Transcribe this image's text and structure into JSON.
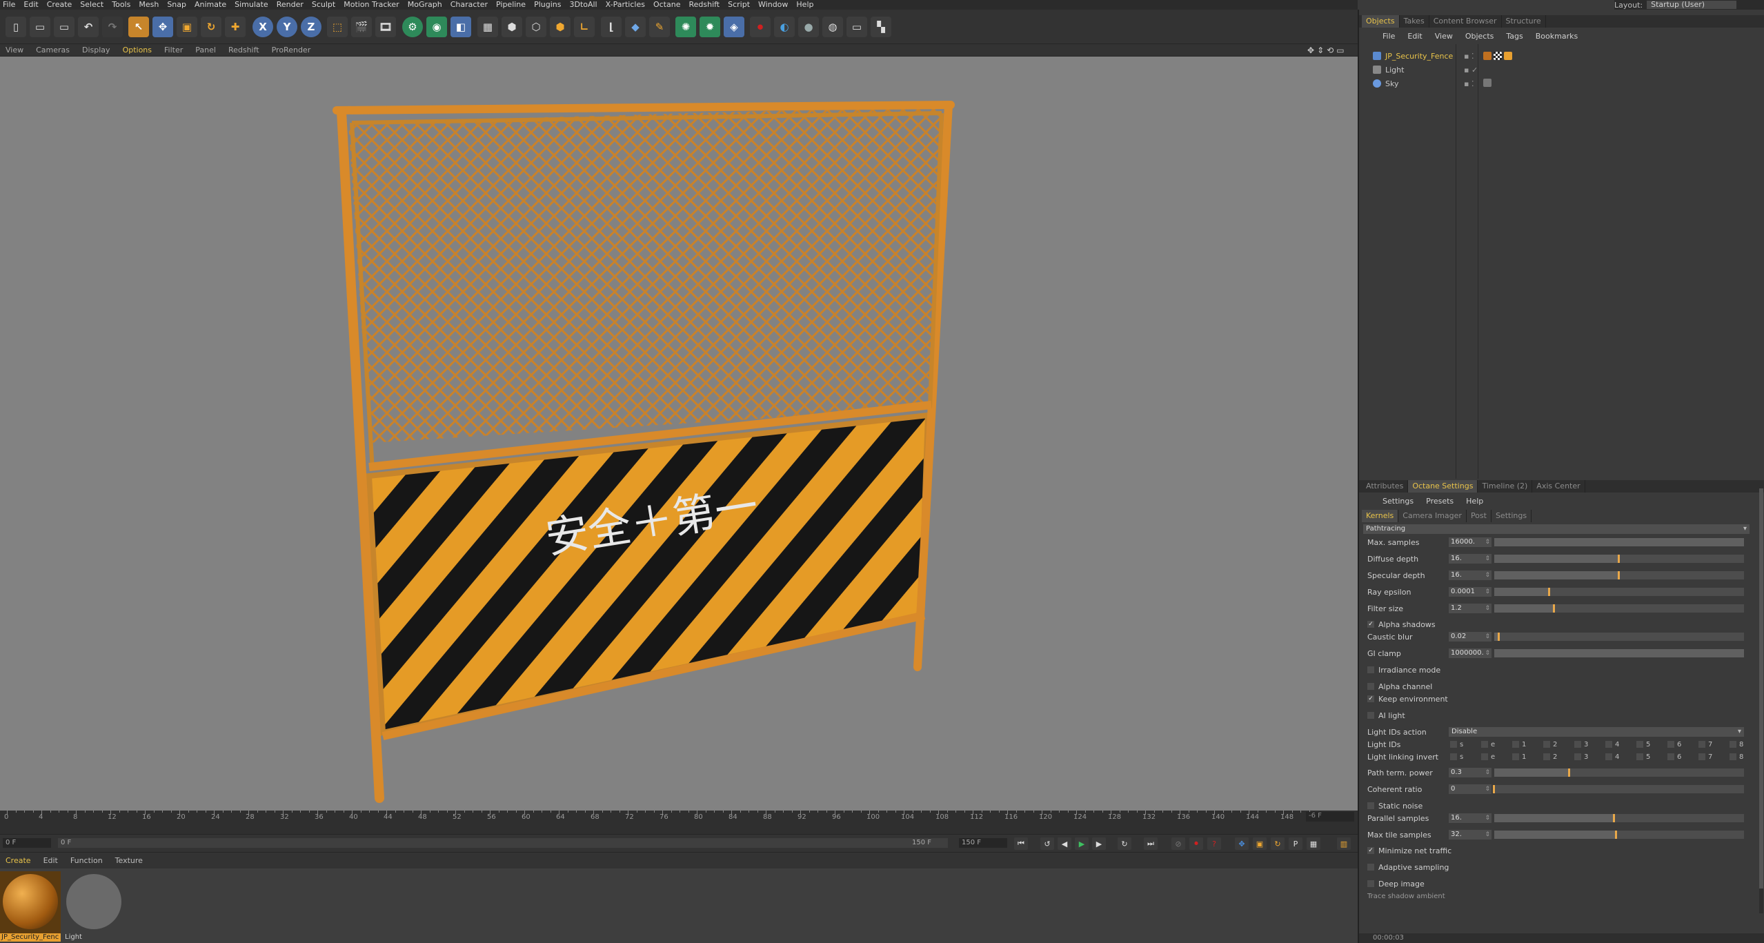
{
  "menu": [
    "File",
    "Edit",
    "Create",
    "Select",
    "Tools",
    "Mesh",
    "Snap",
    "Animate",
    "Simulate",
    "Render",
    "Sculpt",
    "Motion Tracker",
    "MoGraph",
    "Character",
    "Pipeline",
    "Plugins",
    "3DtoAll",
    "X-Particles",
    "Octane",
    "Redshift",
    "Script",
    "Window",
    "Help"
  ],
  "layout": {
    "label": "Layout:",
    "value": "Startup (User)"
  },
  "viewport_menu": [
    "View",
    "Cameras",
    "Display",
    "Options",
    "Filter",
    "Panel",
    "Redshift",
    "ProRender"
  ],
  "viewport_menu_highlight": "Options",
  "toolbar": {
    "x_axis": "X",
    "y_axis": "Y",
    "z_axis": "Z"
  },
  "fence_sign_text": "安全＋第一",
  "timeline": {
    "ticks": [
      "0",
      "4",
      "8",
      "12",
      "16",
      "20",
      "24",
      "28",
      "32",
      "36",
      "40",
      "44",
      "48",
      "52",
      "56",
      "60",
      "64",
      "68",
      "72",
      "76",
      "80",
      "84",
      "88",
      "92",
      "96",
      "100",
      "104",
      "108",
      "112",
      "116",
      "120",
      "124",
      "128",
      "132",
      "136",
      "140",
      "144",
      "148"
    ],
    "current_frame": "-6 F",
    "start_field": "0 F",
    "range_start": "0 F",
    "range_end": "150 F",
    "end_field": "150 F"
  },
  "material_manager": {
    "menu": [
      "Create",
      "Edit",
      "Function",
      "Texture"
    ],
    "materials": [
      {
        "name": "JP_Security_Fenc",
        "selected": true
      },
      {
        "name": "Light",
        "selected": false
      }
    ]
  },
  "object_manager": {
    "tabs": [
      "Objects",
      "Takes",
      "Content Browser",
      "Structure"
    ],
    "active_tab": "Objects",
    "menu": [
      "File",
      "Edit",
      "View",
      "Objects",
      "Tags",
      "Bookmarks"
    ],
    "objects": [
      {
        "name": "JP_Security_Fence",
        "selected": true
      },
      {
        "name": "Light",
        "selected": false
      },
      {
        "name": "Sky",
        "selected": false
      }
    ]
  },
  "attributes": {
    "tabs": [
      "Attributes",
      "Octane Settings",
      "Timeline (2)",
      "Axis Center"
    ],
    "active_tab": "Octane Settings",
    "menu": [
      "Settings",
      "Presets",
      "Help"
    ],
    "subtabs": [
      "Kernels",
      "Camera Imager",
      "Post",
      "Settings"
    ],
    "active_subtab": "Kernels",
    "kernel": "Pathtracing",
    "max_samples": {
      "label": "Max. samples",
      "value": "16000.",
      "fraction": 1.0
    },
    "diffuse_depth": {
      "label": "Diffuse depth",
      "value": "16.",
      "fraction": 0.5
    },
    "specular_depth": {
      "label": "Specular depth",
      "value": "16.",
      "fraction": 0.5
    },
    "ray_epsilon": {
      "label": "Ray epsilon",
      "value": "0.0001",
      "fraction": 0.22
    },
    "filter_size": {
      "label": "Filter size",
      "value": "1.2",
      "fraction": 0.24
    },
    "alpha_shadows": {
      "label": "Alpha shadows",
      "checked": true
    },
    "caustic_blur": {
      "label": "Caustic blur",
      "value": "0.02",
      "fraction": 0.02
    },
    "gi_clamp": {
      "label": "GI clamp",
      "value": "1000000.",
      "fraction": 1.0
    },
    "irradiance_mode": {
      "label": "Irradiance mode",
      "checked": false
    },
    "alpha_channel": {
      "label": "Alpha channel",
      "checked": false
    },
    "keep_environment": {
      "label": "Keep environment",
      "checked": true
    },
    "ai_light": {
      "label": "AI light",
      "checked": false
    },
    "light_ids_action": {
      "label": "Light IDs action",
      "value": "Disable"
    },
    "light_ids": {
      "label": "Light IDs",
      "items": [
        "s",
        "e",
        "1",
        "2",
        "3",
        "4",
        "5",
        "6",
        "7",
        "8"
      ]
    },
    "light_linking_invert": {
      "label": "Light linking invert",
      "items": [
        "s",
        "e",
        "1",
        "2",
        "3",
        "4",
        "5",
        "6",
        "7",
        "8"
      ]
    },
    "path_term_power": {
      "label": "Path term. power",
      "value": "0.3",
      "fraction": 0.3
    },
    "coherent_ratio": {
      "label": "Coherent ratio",
      "value": "0",
      "fraction": 0.0
    },
    "static_noise": {
      "label": "Static noise",
      "checked": false
    },
    "parallel_samples": {
      "label": "Parallel samples",
      "value": "16.",
      "fraction": 0.48
    },
    "max_tile_samples": {
      "label": "Max tile samples",
      "value": "32.",
      "fraction": 0.49
    },
    "minimize_net_traffic": {
      "label": "Minimize net traffic",
      "checked": true
    },
    "adaptive_sampling": {
      "label": "Adaptive sampling",
      "checked": false
    },
    "deep_image": {
      "label": "Deep image",
      "checked": false
    },
    "trunc_label": "Trace shadow ambient",
    "status_time": "00:00:03"
  },
  "colors": {
    "accent": "#e8c34a",
    "fence_orange": "#d98a2a",
    "stripe_black": "#1a1a1a",
    "viewport_bg": "#828282"
  }
}
